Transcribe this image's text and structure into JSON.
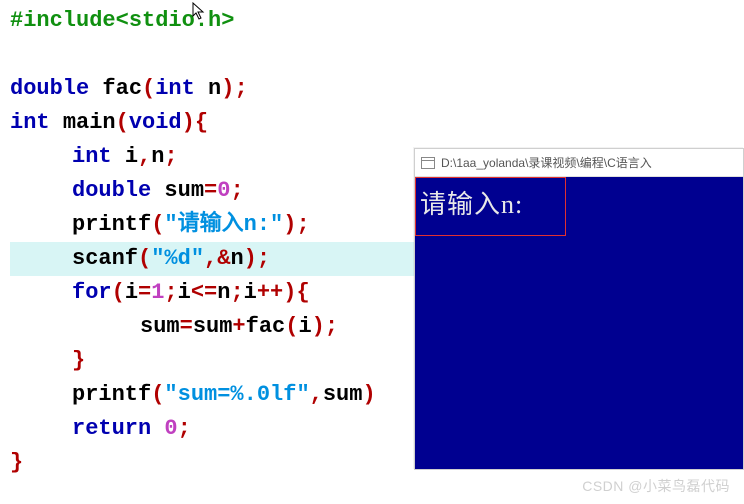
{
  "code": {
    "l0_include": "#include",
    "l0_lt": "<",
    "l0_header": "stdio.h",
    "l0_gt": ">",
    "l1_type": "double",
    "l1_fn": "fac",
    "l1_lp": "(",
    "l1_argtype": "int",
    "l1_arg": "n",
    "l1_rp": ")",
    "l1_semi": ";",
    "l2_type": "int",
    "l2_fn": "main",
    "l2_lp": "(",
    "l2_void": "void",
    "l2_rp": ")",
    "l2_lb": "{",
    "l3_type": "int",
    "l3_vars": "i",
    "l3_comma": ",",
    "l3_var2": "n",
    "l3_semi": ";",
    "l4_type": "double",
    "l4_var": "sum",
    "l4_eq": "=",
    "l4_zero": "0",
    "l4_semi": ";",
    "l5_fn": "printf",
    "l5_lp": "(",
    "l5_str": "\"请输入n:\"",
    "l5_rp": ")",
    "l5_semi": ";",
    "l6_fn": "scanf",
    "l6_lp": "(",
    "l6_str": "\"%d\"",
    "l6_comma": ",",
    "l6_amp": "&",
    "l6_var": "n",
    "l6_rp": ")",
    "l6_semi": ";",
    "l7_kw": "for",
    "l7_lp": "(",
    "l7_i": "i",
    "l7_eq": "=",
    "l7_one": "1",
    "l7_semi1": ";",
    "l7_i2": "i",
    "l7_le": "<=",
    "l7_n": "n",
    "l7_semi2": ";",
    "l7_i3": "i",
    "l7_inc": "++",
    "l7_rp": ")",
    "l7_lb": "{",
    "l8_sum": "sum",
    "l8_eq": "=",
    "l8_sum2": "sum",
    "l8_plus": "+",
    "l8_fac": "fac",
    "l8_lp": "(",
    "l8_i": "i",
    "l8_rp": ")",
    "l8_semi": ";",
    "l9_rb": "}",
    "l10_fn": "printf",
    "l10_lp": "(",
    "l10_str": "\"sum=%.0lf\"",
    "l10_comma": ",",
    "l10_var": "sum",
    "l10_rp": ")",
    "l11_kw": "return",
    "l11_zero": "0",
    "l11_semi": ";",
    "l12_rb": "}"
  },
  "terminal": {
    "title": "D:\\1aa_yolanda\\录课视频\\编程\\C语言入",
    "prompt": "请输入n:"
  },
  "watermark": "CSDN @小菜鸟磊代码"
}
